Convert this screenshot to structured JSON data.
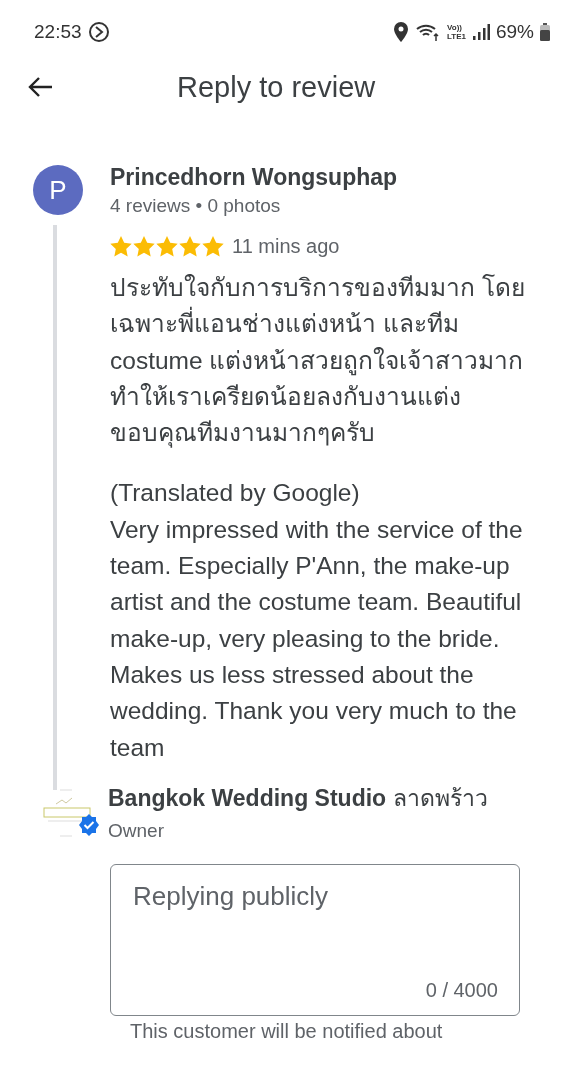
{
  "status_bar": {
    "time": "22:53",
    "network": "Vo))\nLTE1",
    "battery": "69%"
  },
  "header": {
    "title": "Reply to review"
  },
  "review": {
    "avatar_letter": "P",
    "author": "Princedhorn Wongsuphap",
    "meta": "4 reviews • 0 photos",
    "stars": 5,
    "time": "11 mins ago",
    "paragraphs": [
      "ประทับใจกับการบริการของทีมมาก โดยเฉพาะพี่แอนช่างแต่งหน้า และทีม costume แต่งหน้าสวยถูกใจเจ้าสาวมาก ทำให้เราเครียดน้อยลงกับงานแต่ง ขอบคุณทีมงานมากๆครับ",
      "(Translated by Google)\nVery impressed with the service of the team. Especially P'Ann, the make-up artist and the costume team. Beautiful make-up, very pleasing to the bride. Makes us less stressed about the wedding. Thank you very much to the team"
    ]
  },
  "owner": {
    "name": "Bangkok Wedding Studio",
    "name_local": "ลาดพร้าว",
    "role": "Owner",
    "verified": true
  },
  "reply": {
    "placeholder": "Replying publicly",
    "counter": "0 / 4000",
    "note": "This customer will be notified about"
  }
}
